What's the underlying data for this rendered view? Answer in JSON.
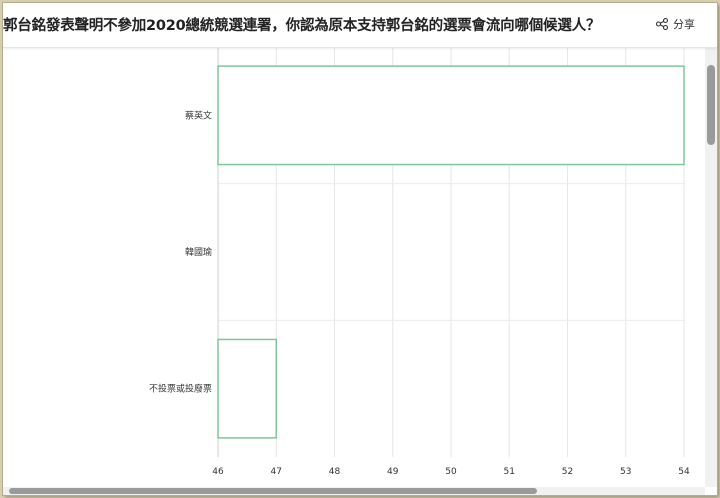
{
  "page": {
    "title": "郭台銘發表聲明不參加2020總統競選連署，你認為原本支持郭台銘的選票會流向哪個候選人？",
    "share_label": "分享",
    "share_icon": "share-icon"
  },
  "chart_data": {
    "type": "bar",
    "orientation": "horizontal",
    "categories": [
      "蔡英文",
      "韓國瑜",
      "不投票或投廢票"
    ],
    "values": [
      54,
      46,
      47
    ],
    "xlim": [
      46,
      54
    ],
    "xticks": [
      46,
      47,
      48,
      49,
      50,
      51,
      52,
      53,
      54
    ],
    "grid": true,
    "bar_color": "#7fc79a",
    "bar_fill": "#ffffff"
  }
}
